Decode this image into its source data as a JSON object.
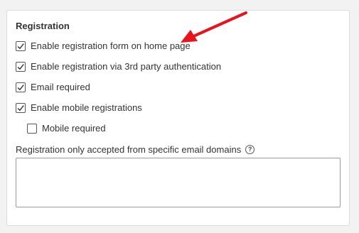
{
  "section": {
    "title": "Registration"
  },
  "options": [
    {
      "label": "Enable registration form on home page",
      "checked": true
    },
    {
      "label": "Enable registration via 3rd party authentication",
      "checked": true
    },
    {
      "label": "Email required",
      "checked": true
    },
    {
      "label": "Enable mobile registrations",
      "checked": true
    },
    {
      "label": "Mobile required",
      "checked": false
    }
  ],
  "domains": {
    "label": "Registration only accepted from specific email domains",
    "value": "",
    "help_icon": "question-circle-icon"
  },
  "annotation": {
    "arrow_color": "#e8141b"
  }
}
